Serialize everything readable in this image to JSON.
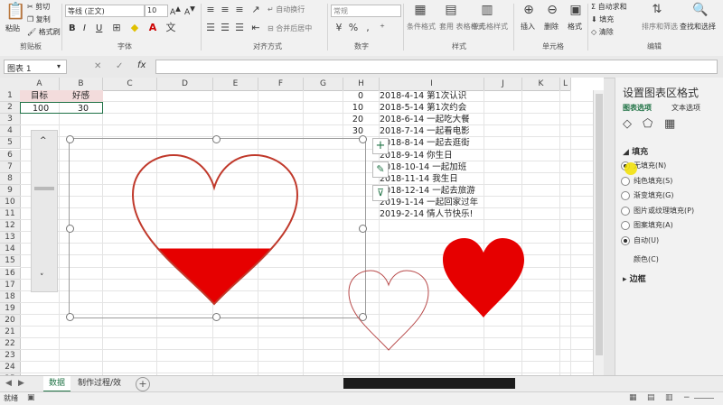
{
  "ribbon": {
    "clipboard": {
      "paste": "粘贴",
      "cut": "剪切",
      "copy": "复制",
      "format_painter": "格式刷",
      "group": "剪贴板"
    },
    "font": {
      "name": "等线 (正文)",
      "size": "10",
      "bold": "B",
      "italic": "I",
      "underline": "U",
      "group": "字体"
    },
    "alignment": {
      "wrap": "自动换行",
      "merge": "合并后居中",
      "group": "对齐方式"
    },
    "number": {
      "format": "常规",
      "group": "数字"
    },
    "styles": {
      "conditional": "条件格式",
      "table": "套用\n表格格式",
      "cell": "单元格样式",
      "group": "样式"
    },
    "cells": {
      "insert": "插入",
      "delete": "删除",
      "format": "格式",
      "group": "单元格"
    },
    "editing": {
      "autosum": "自动求和",
      "fill": "填充",
      "clear": "清除",
      "sort": "排序和筛选",
      "find": "查找和选择",
      "group": "编辑"
    }
  },
  "formula_bar": {
    "name_box": "图表 1",
    "fx": "fx",
    "cancel": "✕",
    "enter": "✓",
    "content": ""
  },
  "grid": {
    "columns": [
      "A",
      "B",
      "C",
      "D",
      "E",
      "F",
      "G",
      "H",
      "I",
      "J",
      "K",
      "L"
    ],
    "rows": [
      "1",
      "2",
      "3",
      "4",
      "5",
      "6",
      "7",
      "8",
      "9",
      "10",
      "11",
      "12",
      "13",
      "14",
      "15",
      "16",
      "17",
      "18",
      "19",
      "20",
      "21",
      "22",
      "23",
      "24",
      "25"
    ],
    "a1": "目标",
    "b1": "好感",
    "a2": "100",
    "b2": "30",
    "h_values": [
      "0",
      "10",
      "20",
      "30"
    ],
    "timeline": [
      "2018-4-14  第1次认识",
      "2018-5-14  第1次约会",
      "2018-6-14  一起吃大餐",
      "2018-7-14  一起看电影",
      "2018-8-14  一起去逛街",
      "2018-9-14  你生日",
      "2018-10-14  一起加班",
      "2018-11-14  我生日",
      "2018-12-14  一起去旅游",
      "2019-1-14  一起回家过年",
      "2019-2-14  情人节快乐!"
    ]
  },
  "chart_tools": {
    "plus": "+",
    "brush": "✎",
    "filter": "⊽"
  },
  "heart_fill": {
    "fraction": 0.3,
    "target": 100,
    "value": 30
  },
  "pane": {
    "title": "设置图表区格式",
    "tab_chart": "图表选项",
    "tab_text": "文本选项",
    "section_fill": "填充",
    "options": [
      "无填充(N)",
      "纯色填充(S)",
      "渐变填充(G)",
      "图片或纹理填充(P)",
      "图案填充(A)",
      "自动(U)"
    ],
    "color_label": "颜色(C)",
    "section_border": "边框"
  },
  "sheets": [
    "数据",
    "制作过程/效果"
  ],
  "status": {
    "ready": "就绪"
  },
  "colors": {
    "heart_red": "#e60000",
    "outline_red": "#c0392b",
    "accent_green": "#217346"
  }
}
